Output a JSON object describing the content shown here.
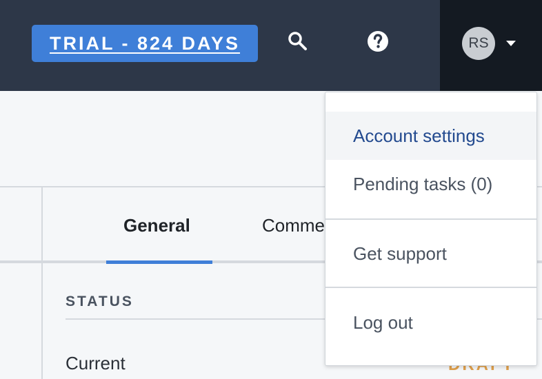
{
  "topbar": {
    "trial_label": "TRIAL - 824 DAYS",
    "user_initials": "RS",
    "colors": {
      "bar": "#2d3748",
      "accent": "#3f7fd8"
    }
  },
  "tabs": [
    {
      "label": "General",
      "active": true
    },
    {
      "label": "Comme"
    }
  ],
  "section": {
    "label": "STATUS",
    "field_label": "Current",
    "field_value": "DRAFT"
  },
  "user_menu": {
    "items": [
      {
        "label": "Account settings"
      },
      {
        "label": "Pending tasks (0)"
      },
      {
        "label": "Get support"
      },
      {
        "label": "Log out"
      }
    ]
  },
  "icons": [
    "search-icon",
    "help-icon",
    "chevron-down-icon"
  ]
}
